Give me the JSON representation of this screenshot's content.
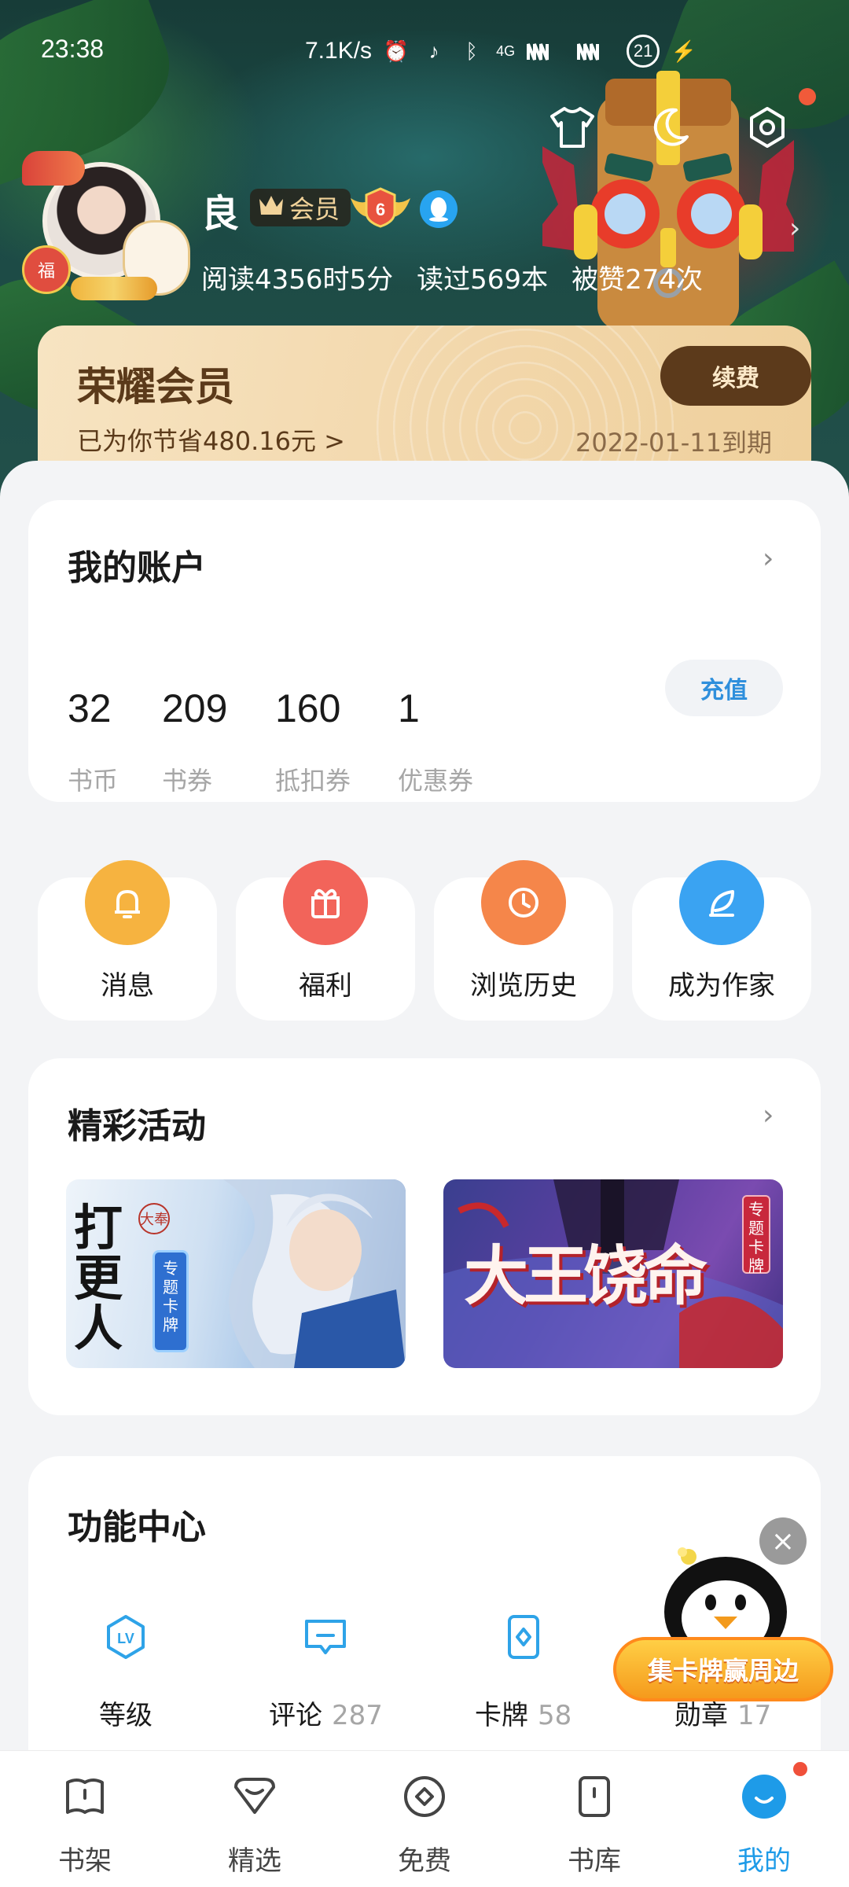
{
  "status_bar": {
    "time": "23:38",
    "net_speed": "7.1K/s",
    "signal_label": "4G",
    "battery": "21"
  },
  "profile": {
    "name": "良",
    "vip_badge": "会员",
    "level": "6",
    "stats": {
      "read_time": "阅读4356时5分",
      "books_read": "读过569本",
      "likes": "被赞274次"
    },
    "avatar_bag_text": "福"
  },
  "vip_card": {
    "title": "荣耀会员",
    "savings": "已为你节省480.16元 >",
    "renew_label": "续费",
    "expire": "2022-01-11到期"
  },
  "account": {
    "title": "我的账户",
    "items": [
      {
        "value": "32",
        "label": "书币"
      },
      {
        "value": "209",
        "label": "书券"
      },
      {
        "value": "160",
        "label": "抵扣券"
      },
      {
        "value": "1",
        "label": "优惠券"
      }
    ],
    "recharge_label": "充值"
  },
  "quick_actions": [
    {
      "label": "消息",
      "icon": "bell-icon",
      "color": "#f6b340"
    },
    {
      "label": "福利",
      "icon": "gift-icon",
      "color": "#f2645a"
    },
    {
      "label": "浏览历史",
      "icon": "clock-icon",
      "color": "#f5864a"
    },
    {
      "label": "成为作家",
      "icon": "feather-icon",
      "color": "#3aa3f2"
    }
  ],
  "activities": {
    "title": "精彩活动",
    "banners": [
      {
        "title": "打更人",
        "tag": "专题卡牌",
        "corner": "大奉"
      },
      {
        "title": "大王饶命",
        "tag": "专题卡牌"
      }
    ]
  },
  "features": {
    "title": "功能中心",
    "items": [
      {
        "label": "等级",
        "count": "",
        "icon": "level-icon"
      },
      {
        "label": "评论",
        "count": "287",
        "icon": "comment-icon"
      },
      {
        "label": "卡牌",
        "count": "58",
        "icon": "card-icon"
      },
      {
        "label": "勋章",
        "count": "17",
        "icon": "medal-icon"
      }
    ]
  },
  "promo": {
    "label": "集卡牌赢周边"
  },
  "bottom_nav": [
    {
      "label": "书架",
      "active": false
    },
    {
      "label": "精选",
      "active": false
    },
    {
      "label": "免费",
      "active": false
    },
    {
      "label": "书库",
      "active": false
    },
    {
      "label": "我的",
      "active": true
    }
  ],
  "colors": {
    "accent": "#1e9be8",
    "vip_brown": "#5c3a1b",
    "vip_gold": "#f2d7ab",
    "badge_red": "#f0503a"
  }
}
